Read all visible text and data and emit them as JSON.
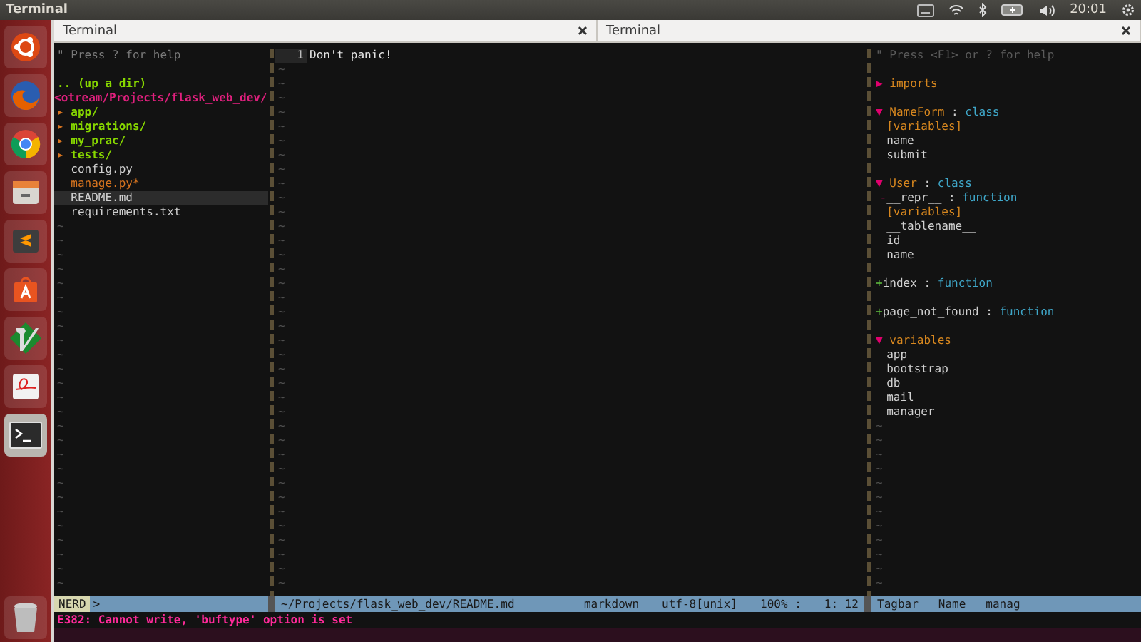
{
  "top_bar": {
    "title": "Terminal",
    "clock": "20:01"
  },
  "launcher": [
    {
      "kind": "ubuntu",
      "active": false
    },
    {
      "kind": "firefox",
      "active": false
    },
    {
      "kind": "chrome",
      "active": false
    },
    {
      "kind": "files",
      "active": false
    },
    {
      "kind": "sublime",
      "active": false
    },
    {
      "kind": "software",
      "active": false
    },
    {
      "kind": "vim",
      "active": false
    },
    {
      "kind": "reader",
      "active": false
    },
    {
      "kind": "terminal",
      "active": true
    },
    {
      "kind": "trash",
      "active": false
    }
  ],
  "tabs": [
    {
      "label": "Terminal"
    },
    {
      "label": "Terminal"
    }
  ],
  "empty_line_marker": "~",
  "nerdtree": {
    "help": "\" Press ? for help",
    "up": ".. (up a dir)",
    "root": "<otream/Projects/flask_web_dev/",
    "entries": [
      {
        "kind": "dir",
        "marker": "▸",
        "name": "app/",
        "selected": false
      },
      {
        "kind": "dir",
        "marker": "▸",
        "name": "migrations/",
        "selected": false
      },
      {
        "kind": "dir",
        "marker": "▸",
        "name": "my_prac/",
        "selected": false
      },
      {
        "kind": "dir",
        "marker": "▸",
        "name": "tests/",
        "selected": false
      },
      {
        "kind": "file",
        "name": "config.py",
        "selected": false
      },
      {
        "kind": "exec",
        "name": "manage.py*",
        "selected": false
      },
      {
        "kind": "file",
        "name": "README.md",
        "selected": true
      },
      {
        "kind": "file",
        "name": "requirements.txt",
        "selected": false
      }
    ]
  },
  "editor": {
    "lines": [
      {
        "number": "1",
        "text": "Don't panic!"
      }
    ]
  },
  "tagbar": {
    "help": "\" Press <F1> or ? for help",
    "lines": [
      {
        "kind": "gap"
      },
      {
        "kind": "header",
        "marker": "▶",
        "name": "imports"
      },
      {
        "kind": "gap"
      },
      {
        "kind": "header",
        "marker": "▼",
        "name": "NameForm",
        "colon": ":",
        "type": "class"
      },
      {
        "kind": "group",
        "name": "[variables]"
      },
      {
        "kind": "member",
        "name": "name"
      },
      {
        "kind": "member",
        "name": "submit"
      },
      {
        "kind": "gap"
      },
      {
        "kind": "header",
        "marker": "▼",
        "name": "User",
        "colon": ":",
        "type": "class"
      },
      {
        "kind": "method",
        "marker": "-",
        "name": "__repr__",
        "colon": ":",
        "type": "function"
      },
      {
        "kind": "group",
        "name": "[variables]"
      },
      {
        "kind": "member",
        "name": "__tablename__"
      },
      {
        "kind": "member",
        "name": "id"
      },
      {
        "kind": "member",
        "name": "name"
      },
      {
        "kind": "gap"
      },
      {
        "kind": "toplevel",
        "marker": "+",
        "name": "index",
        "colon": ":",
        "type": "function"
      },
      {
        "kind": "gap"
      },
      {
        "kind": "toplevel",
        "marker": "+",
        "name": "page_not_found",
        "colon": ":",
        "type": "function"
      },
      {
        "kind": "gap"
      },
      {
        "kind": "header",
        "marker": "▼",
        "name": "variables"
      },
      {
        "kind": "member",
        "name": "app"
      },
      {
        "kind": "member",
        "name": "bootstrap"
      },
      {
        "kind": "member",
        "name": "db"
      },
      {
        "kind": "member",
        "name": "mail"
      },
      {
        "kind": "member",
        "name": "manager"
      }
    ]
  },
  "status": {
    "mode": "NERD",
    "arrow": ">",
    "file": "~/Projects/flask_web_dev/README.md",
    "filetype": "markdown",
    "encoding": "utf-8[unix]",
    "percent": "100% :",
    "position": "1: 12",
    "plugin": "Tagbar",
    "sort": "Name",
    "tag": "manag"
  },
  "message": "E382: Cannot write, 'buftype' option is set"
}
